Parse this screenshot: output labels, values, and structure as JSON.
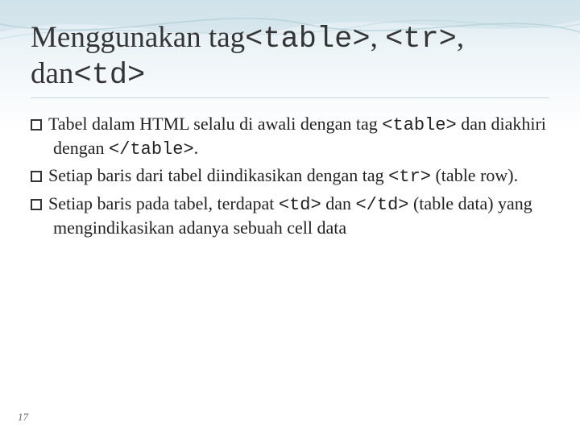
{
  "title": {
    "t1": "Menggunakan tag",
    "t2": "<table>",
    "t3": ", ",
    "t4": "<tr>",
    "t5": ", dan",
    "t6": "<td>"
  },
  "bullets": [
    {
      "a": "Tabel dalam HTML selalu di awali dengan tag ",
      "b": "<table>",
      "c": " dan diakhiri dengan ",
      "d": "</table>",
      "e": "."
    },
    {
      "a": "Setiap baris dari tabel diindikasikan dengan tag ",
      "b": "<tr>",
      "c": " (table row)."
    },
    {
      "a": "Setiap baris pada tabel, terdapat  ",
      "b": "<td>",
      "c": " dan ",
      "d": "</td>",
      "e": " (table data) yang mengindikasikan adanya sebuah cell data"
    }
  ],
  "page_number": "17"
}
